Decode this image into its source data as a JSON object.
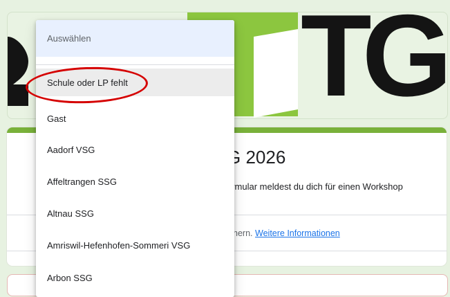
{
  "header": {
    "logo_text": "TG",
    "colors": {
      "green": "#8cc63f",
      "dark": "#141414",
      "background": "#e9f3e3"
    }
  },
  "form": {
    "title": "G 2026",
    "description": "ormular meldest du dich für einen Workshop",
    "info_text": "ichern.",
    "info_link": "Weitere Informationen",
    "accent_color": "#79b13a"
  },
  "dropdown": {
    "placeholder": "Auswählen",
    "options": [
      "Schule oder LP fehlt",
      "Gast",
      "Aadorf VSG",
      "Affeltrangen SSG",
      "Altnau SSG",
      "Amriswil-Hefenhofen-Sommeri VSG",
      "Arbon SSG"
    ],
    "highlighted_index": 0
  },
  "annotation": {
    "color": "#d50000"
  }
}
